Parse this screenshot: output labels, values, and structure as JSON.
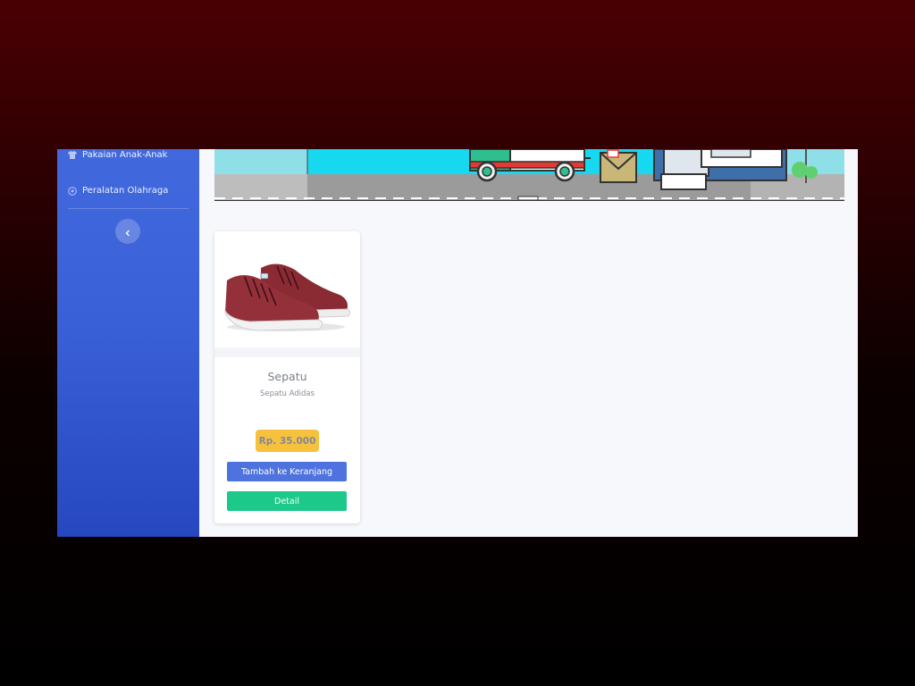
{
  "sidebar": {
    "items": [
      {
        "label": "Pakaian Anak-Anak",
        "icon": "shirt-icon"
      },
      {
        "label": "Peralatan Olahraga",
        "icon": "soccer-ball-icon"
      }
    ],
    "toggle_icon": "chevron-left-icon"
  },
  "banner": {
    "illustration": "delivery-van-street-illustration"
  },
  "products": [
    {
      "name": "Sepatu",
      "description": "Sepatu Adidas",
      "price": "Rp. 35.000",
      "add_to_cart_label": "Tambah ke Keranjang",
      "detail_label": "Detail"
    }
  ],
  "colors": {
    "sidebar": "#4169dd",
    "primary": "#4e73df",
    "success": "#1cc88a",
    "warning": "#f6c23e",
    "content_bg": "#f7f8fc"
  }
}
